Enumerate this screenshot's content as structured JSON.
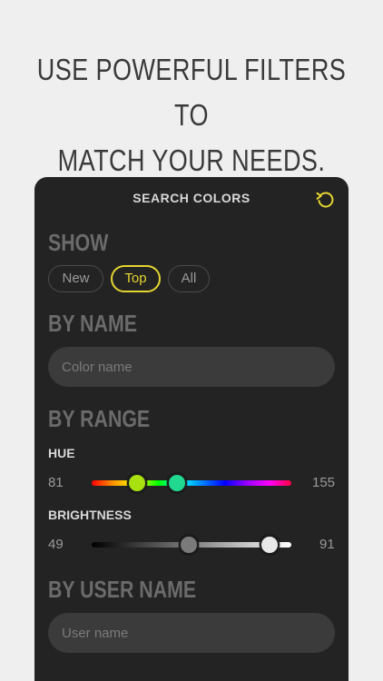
{
  "headline": {
    "line1": "USE POWERFUL FILTERS TO",
    "line2": "MATCH YOUR NEEDS."
  },
  "panel": {
    "title": "SEARCH COLORS",
    "reset_icon": "reset-icon",
    "accent_color": "#e5d530",
    "background_color": "#232323"
  },
  "show": {
    "title": "SHOW",
    "options": [
      {
        "label": "New",
        "active": false
      },
      {
        "label": "Top",
        "active": true
      },
      {
        "label": "All",
        "active": false
      }
    ]
  },
  "by_name": {
    "title": "BY NAME",
    "placeholder": "Color name",
    "value": ""
  },
  "by_range": {
    "title": "BY RANGE",
    "hue": {
      "label": "HUE",
      "min_value": "81",
      "max_value": "155",
      "thumb_low_color": "#a8e010",
      "thumb_high_color": "#20d890"
    },
    "brightness": {
      "label": "BRIGHTNESS",
      "min_value": "49",
      "max_value": "91",
      "thumb_low_color": "#7a7a7a",
      "thumb_high_color": "#e8e8e8"
    }
  },
  "by_user_name": {
    "title": "BY USER NAME",
    "placeholder": "User name",
    "value": ""
  }
}
